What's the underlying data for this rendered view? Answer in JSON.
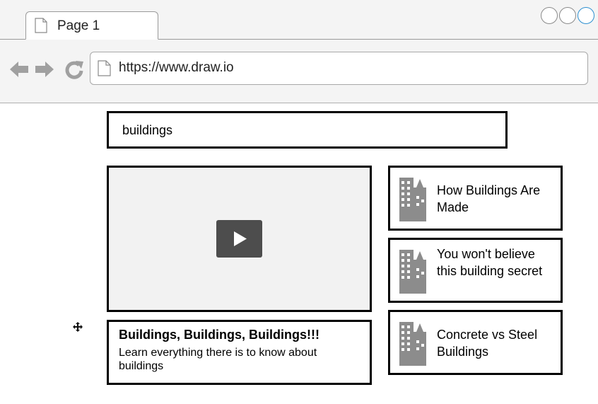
{
  "window": {
    "tab_label": "Page 1",
    "icons": {
      "page": "page-icon",
      "back": "arrow-left-icon",
      "forward": "arrow-right-icon",
      "reload": "reload-icon",
      "play": "play-icon",
      "building": "building-icon",
      "move": "move-icon"
    }
  },
  "address_bar": {
    "url": "https://www.draw.io"
  },
  "search": {
    "value": "buildings"
  },
  "video": {
    "title": "Buildings, Buildings, Buildings!!!",
    "description": "Learn everything there is to know about buildings"
  },
  "related": [
    {
      "title": "How Buildings Are Made"
    },
    {
      "title": "You won't believe this building secret"
    },
    {
      "title": "Concrete vs Steel Buildings"
    }
  ],
  "colors": {
    "chrome_bg": "#f4f4f4",
    "border": "#000000",
    "play_button": "#4d4d4d",
    "icon_gray": "#8c8c8c",
    "maximize_accent": "#2c8fd0"
  }
}
